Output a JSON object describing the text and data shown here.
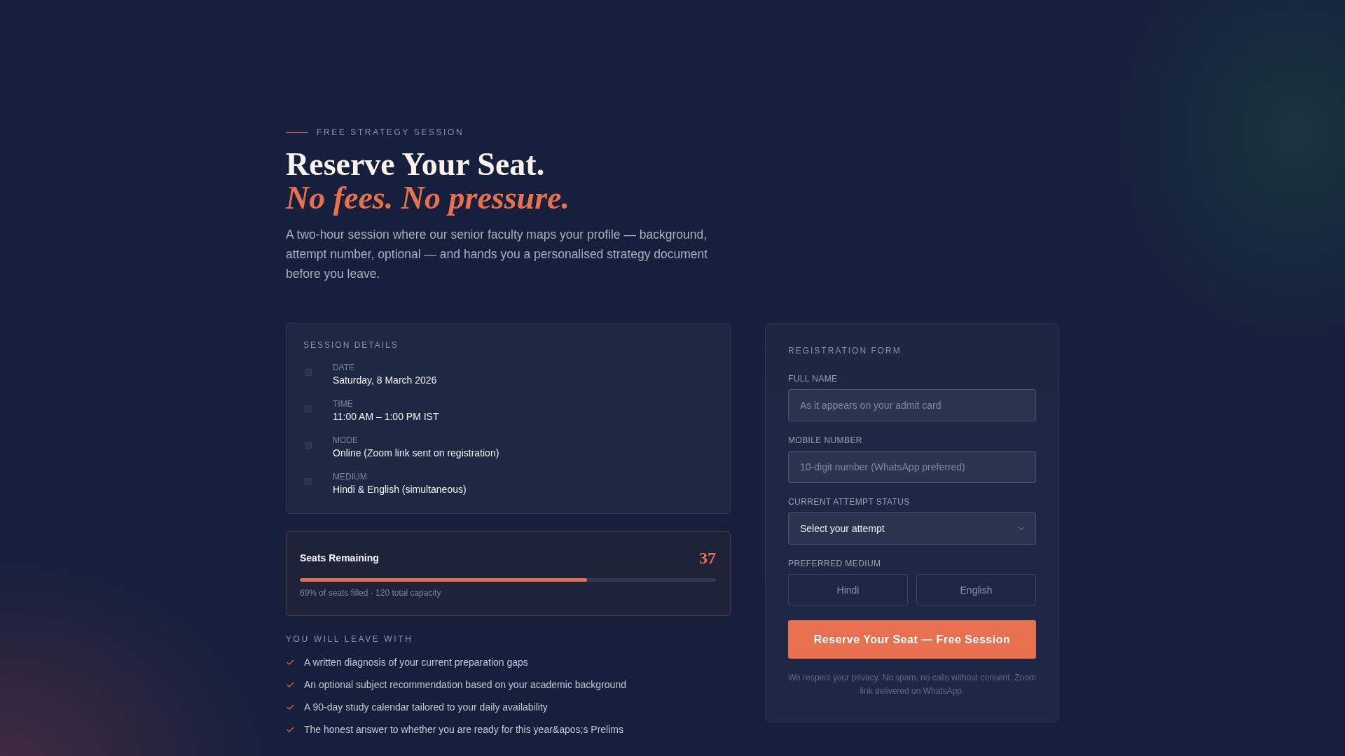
{
  "eyebrow": "FREE STRATEGY SESSION",
  "heading": {
    "line_1": "Reserve Your Seat.",
    "line_2": "No fees. No pressure."
  },
  "intro": "A two-hour session where our senior faculty maps your profile — background, attempt number, optional — and hands you a personalised strategy document before you leave.",
  "session_details": {
    "title": "SESSION DETAILS",
    "items": [
      {
        "label": "DATE",
        "value": "Saturday, 8 March 2026"
      },
      {
        "label": "TIME",
        "value": "11:00 AM – 1:00 PM IST"
      },
      {
        "label": "MODE",
        "value": "Online (Zoom link sent on registration)"
      },
      {
        "label": "MEDIUM",
        "value": "Hindi & English (simultaneous)"
      }
    ]
  },
  "seats": {
    "label": "Seats Remaining",
    "count": "37",
    "level": 0.69,
    "caption": "69% of seats filled · 120 total capacity"
  },
  "outcomes": {
    "title": "YOU WILL LEAVE WITH",
    "items": [
      "A written diagnosis of your current preparation gaps",
      "An optional subject recommendation based on your academic background",
      "A 90-day study calendar tailored to your daily availability",
      "The honest answer to whether you are ready for this year&apos;s Prelims"
    ]
  },
  "form": {
    "title": "REGISTRATION FORM",
    "fields": [
      {
        "kind": "text",
        "label": "FULL NAME",
        "placeholder": "As it appears on your admit card"
      },
      {
        "kind": "text",
        "label": "MOBILE NUMBER",
        "placeholder": "10-digit number (WhatsApp preferred)"
      },
      {
        "kind": "select",
        "label": "CURRENT ATTEMPT STATUS",
        "value": "Select your attempt"
      }
    ],
    "medium": {
      "label": "PREFERRED MEDIUM",
      "options": [
        {
          "label": "Hindi",
          "selected": false
        },
        {
          "label": "English",
          "selected": false
        }
      ]
    },
    "submit": "Reserve Your Seat — Free Session",
    "note": "We respect your privacy. No spam, no calls without consent. Zoom link delivered on WhatsApp."
  }
}
